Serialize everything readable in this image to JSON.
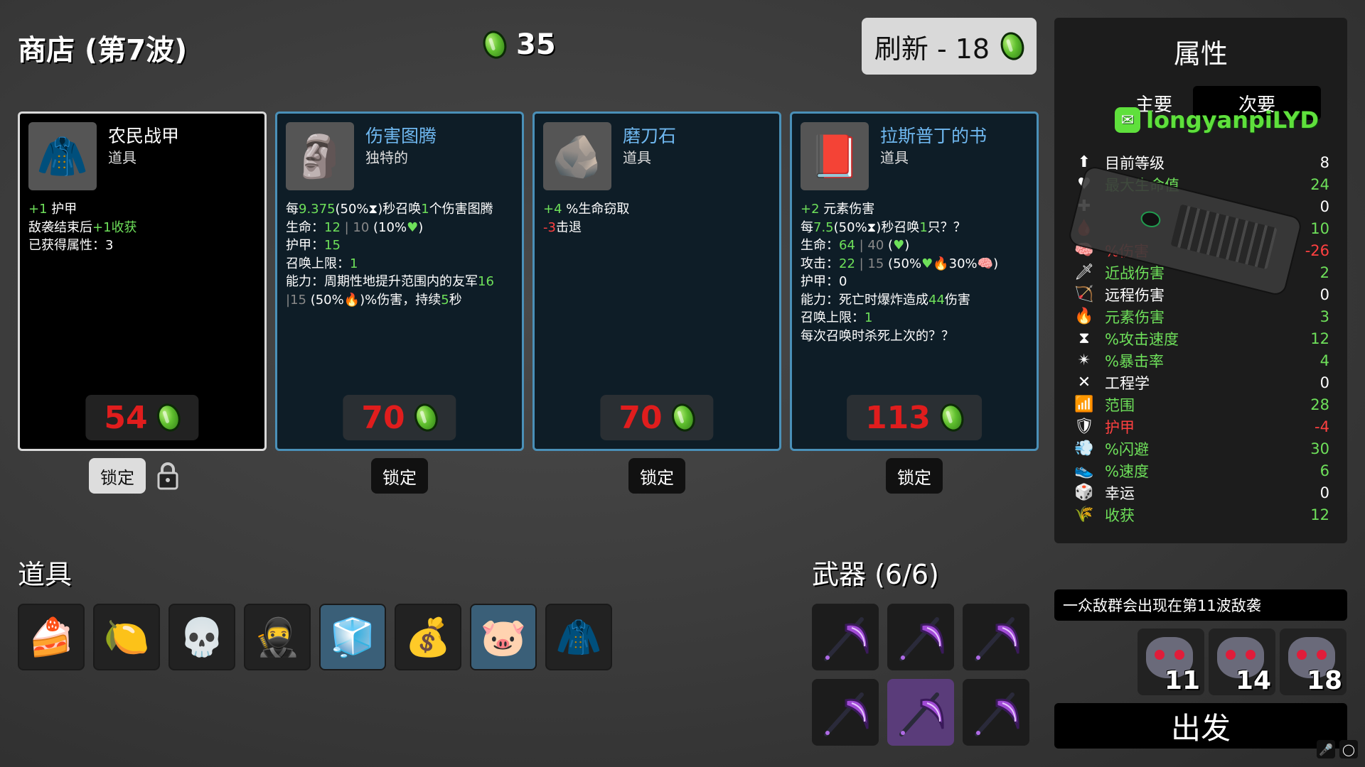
{
  "shop": {
    "title": "商店 (第7波)",
    "money": "35",
    "refresh_label": "刷新 - 18"
  },
  "cards": [
    {
      "name": "农民战甲",
      "type": "道具",
      "price": "54",
      "icon": "peasant-armor-icon",
      "lines": [
        [
          {
            "t": "+1",
            "c": "g"
          },
          {
            "t": " 护甲"
          }
        ],
        [
          {
            "t": "敌袭结束后"
          },
          {
            "t": "+1",
            "c": "g"
          },
          {
            "t": "收获",
            "c": "g"
          }
        ],
        [
          {
            "t": "已获得属性：3"
          }
        ]
      ],
      "lock_label": "锁定",
      "locked": true
    },
    {
      "name": "伤害图腾",
      "type": "独特的",
      "price": "70",
      "icon": "damage-totem-icon",
      "lines": [
        [
          {
            "t": "每"
          },
          {
            "t": "9.375",
            "c": "g"
          },
          {
            "t": "(50%⧗)秒召唤"
          },
          {
            "t": "1",
            "c": "g"
          },
          {
            "t": "个伤害图腾"
          }
        ],
        [
          {
            "t": "生命："
          },
          {
            "t": "12",
            "c": "g"
          },
          {
            "t": " | 10",
            "c": "gr"
          },
          {
            "t": " (10%"
          },
          {
            "t": "♥",
            "c": "g"
          },
          {
            "t": ")"
          }
        ],
        [
          {
            "t": "护甲："
          },
          {
            "t": "15",
            "c": "g"
          }
        ],
        [
          {
            "t": "召唤上限："
          },
          {
            "t": "1",
            "c": "g"
          }
        ],
        [
          {
            "t": "能力：周期性地提升范围内的友军"
          },
          {
            "t": "16",
            "c": "g"
          }
        ],
        [
          {
            "t": " |15",
            "c": "gr"
          },
          {
            "t": " (50%🔥)%伤害，持续"
          },
          {
            "t": "5",
            "c": "g"
          },
          {
            "t": "秒"
          }
        ]
      ],
      "lock_label": "锁定",
      "locked": false
    },
    {
      "name": "磨刀石",
      "type": "道具",
      "price": "70",
      "icon": "whetstone-icon",
      "lines": [
        [
          {
            "t": "+4",
            "c": "g"
          },
          {
            "t": " %生命窃取"
          }
        ],
        [
          {
            "t": "-3",
            "c": "r"
          },
          {
            "t": "击退"
          }
        ]
      ],
      "lock_label": "锁定",
      "locked": false
    },
    {
      "name": "拉斯普丁的书",
      "type": "道具",
      "price": "113",
      "icon": "rasputin-book-icon",
      "lines": [
        [
          {
            "t": "+2",
            "c": "g"
          },
          {
            "t": " 元素伤害"
          }
        ],
        [
          {
            "t": "每"
          },
          {
            "t": "7.5",
            "c": "g"
          },
          {
            "t": "(50%⧗)秒召唤"
          },
          {
            "t": "1",
            "c": "g"
          },
          {
            "t": "只？？"
          }
        ],
        [
          {
            "t": "生命："
          },
          {
            "t": "64",
            "c": "g"
          },
          {
            "t": " | 40",
            "c": "gr"
          },
          {
            "t": " ("
          },
          {
            "t": "♥",
            "c": "g"
          },
          {
            "t": ")"
          }
        ],
        [
          {
            "t": "攻击："
          },
          {
            "t": "22",
            "c": "g"
          },
          {
            "t": " | 15",
            "c": "gr"
          },
          {
            "t": " (50%"
          },
          {
            "t": "♥",
            "c": "g"
          },
          {
            "t": "🔥30%🧠)"
          }
        ],
        [
          {
            "t": "护甲：0"
          }
        ],
        [
          {
            "t": "能力：死亡时爆炸造成"
          },
          {
            "t": "44",
            "c": "g"
          },
          {
            "t": "伤害"
          }
        ],
        [
          {
            "t": "召唤上限："
          },
          {
            "t": "1",
            "c": "g"
          }
        ],
        [
          {
            "t": "每次召唤时杀死上次的？？"
          }
        ]
      ],
      "lock_label": "锁定",
      "locked": false
    }
  ],
  "items": {
    "title": "道具",
    "slots": [
      {
        "icon": "cake-icon",
        "glyph": "🍰",
        "style": ""
      },
      {
        "icon": "lemonade-icon",
        "glyph": "🍋",
        "style": ""
      },
      {
        "icon": "skull-tooth-icon",
        "glyph": "💀",
        "style": ""
      },
      {
        "icon": "ninja-mask-icon",
        "glyph": "🥷",
        "style": ""
      },
      {
        "icon": "ice-totem-icon",
        "glyph": "🧊",
        "style": "blue"
      },
      {
        "icon": "sack-icon",
        "glyph": "💰",
        "style": ""
      },
      {
        "icon": "piggy-bank-icon",
        "glyph": "🐷",
        "style": "blue"
      },
      {
        "icon": "peasant-armor-icon",
        "glyph": "🧥",
        "style": ""
      }
    ]
  },
  "weapons": {
    "title": "武器 (6/6)",
    "count": 6,
    "selected_index": 4
  },
  "stats": {
    "title": "属性",
    "tab_main": "主要",
    "tab_secondary": "次要",
    "watermark": "longyanpiLYD",
    "rows": [
      {
        "icon": "level-icon",
        "glyph": "⬆",
        "label": "目前等级",
        "value": "8",
        "color": "#ffffff"
      },
      {
        "icon": "heart-icon",
        "glyph": "♥",
        "label": "最大生命值",
        "value": "24",
        "color": "#6ee05a"
      },
      {
        "icon": "regen-icon",
        "glyph": "✚",
        "label": "",
        "value": "0",
        "color": "#ffffff"
      },
      {
        "icon": "lifesteal-icon",
        "glyph": "🩸",
        "label": "",
        "value": "10",
        "color": "#6ee05a"
      },
      {
        "icon": "damage-icon",
        "glyph": "🧠",
        "label": "%伤害",
        "value": "-26",
        "color": "#ff4040"
      },
      {
        "icon": "melee-icon",
        "glyph": "🗡",
        "label": "近战伤害",
        "value": "2",
        "color": "#6ee05a"
      },
      {
        "icon": "ranged-icon",
        "glyph": "🏹",
        "label": "远程伤害",
        "value": "0",
        "color": "#ffffff"
      },
      {
        "icon": "elemental-icon",
        "glyph": "🔥",
        "label": "元素伤害",
        "value": "3",
        "color": "#6ee05a"
      },
      {
        "icon": "attack-speed-icon",
        "glyph": "⧗",
        "label": "%攻击速度",
        "value": "12",
        "color": "#6ee05a"
      },
      {
        "icon": "crit-icon",
        "glyph": "✴",
        "label": "%暴击率",
        "value": "4",
        "color": "#6ee05a"
      },
      {
        "icon": "engineering-icon",
        "glyph": "✕",
        "label": "工程学",
        "value": "0",
        "color": "#ffffff"
      },
      {
        "icon": "range-icon",
        "glyph": "📶",
        "label": "范围",
        "value": "28",
        "color": "#6ee05a"
      },
      {
        "icon": "armor-icon",
        "glyph": "🛡",
        "label": "护甲",
        "value": "-4",
        "color": "#ff4040"
      },
      {
        "icon": "dodge-icon",
        "glyph": "💨",
        "label": "%闪避",
        "value": "30",
        "color": "#6ee05a"
      },
      {
        "icon": "speed-icon",
        "glyph": "👟",
        "label": "%速度",
        "value": "6",
        "color": "#6ee05a"
      },
      {
        "icon": "luck-icon",
        "glyph": "🎲",
        "label": "幸运",
        "value": "0",
        "color": "#ffffff"
      },
      {
        "icon": "harvest-icon",
        "glyph": "🌾",
        "label": "收获",
        "value": "12",
        "color": "#6ee05a"
      }
    ]
  },
  "wave_info": "一众敌群会出现在第11波敌袭",
  "enemies": [
    {
      "count": "11"
    },
    {
      "count": "14"
    },
    {
      "count": "18"
    }
  ],
  "go_label": "出发"
}
